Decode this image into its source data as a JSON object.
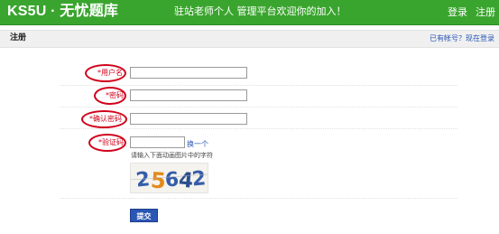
{
  "header": {
    "brand": "KS5U · 无忧题库",
    "welcome": "驻站老师个人  管理平台欢迎你的加入！",
    "login": "登录",
    "register": "注册"
  },
  "subheader": {
    "title": "注册",
    "have_account": "已有帐号？现在登录"
  },
  "form": {
    "username_label": "*用户名",
    "password_label": "*密码",
    "confirm_label": "*确认密码",
    "captcha_label": "*验证码",
    "username_value": "",
    "password_value": "",
    "confirm_value": "",
    "captcha_value": "",
    "change_captcha": "换一个",
    "captcha_hint": "请输入下面动画图片中的字符",
    "captcha_text": "25642",
    "submit": "提交"
  },
  "colors": {
    "header_bg": "#3aa52e",
    "link": "#2a56b4",
    "highlight_circle": "#d0021b",
    "submit_bg": "#2a56b4"
  }
}
